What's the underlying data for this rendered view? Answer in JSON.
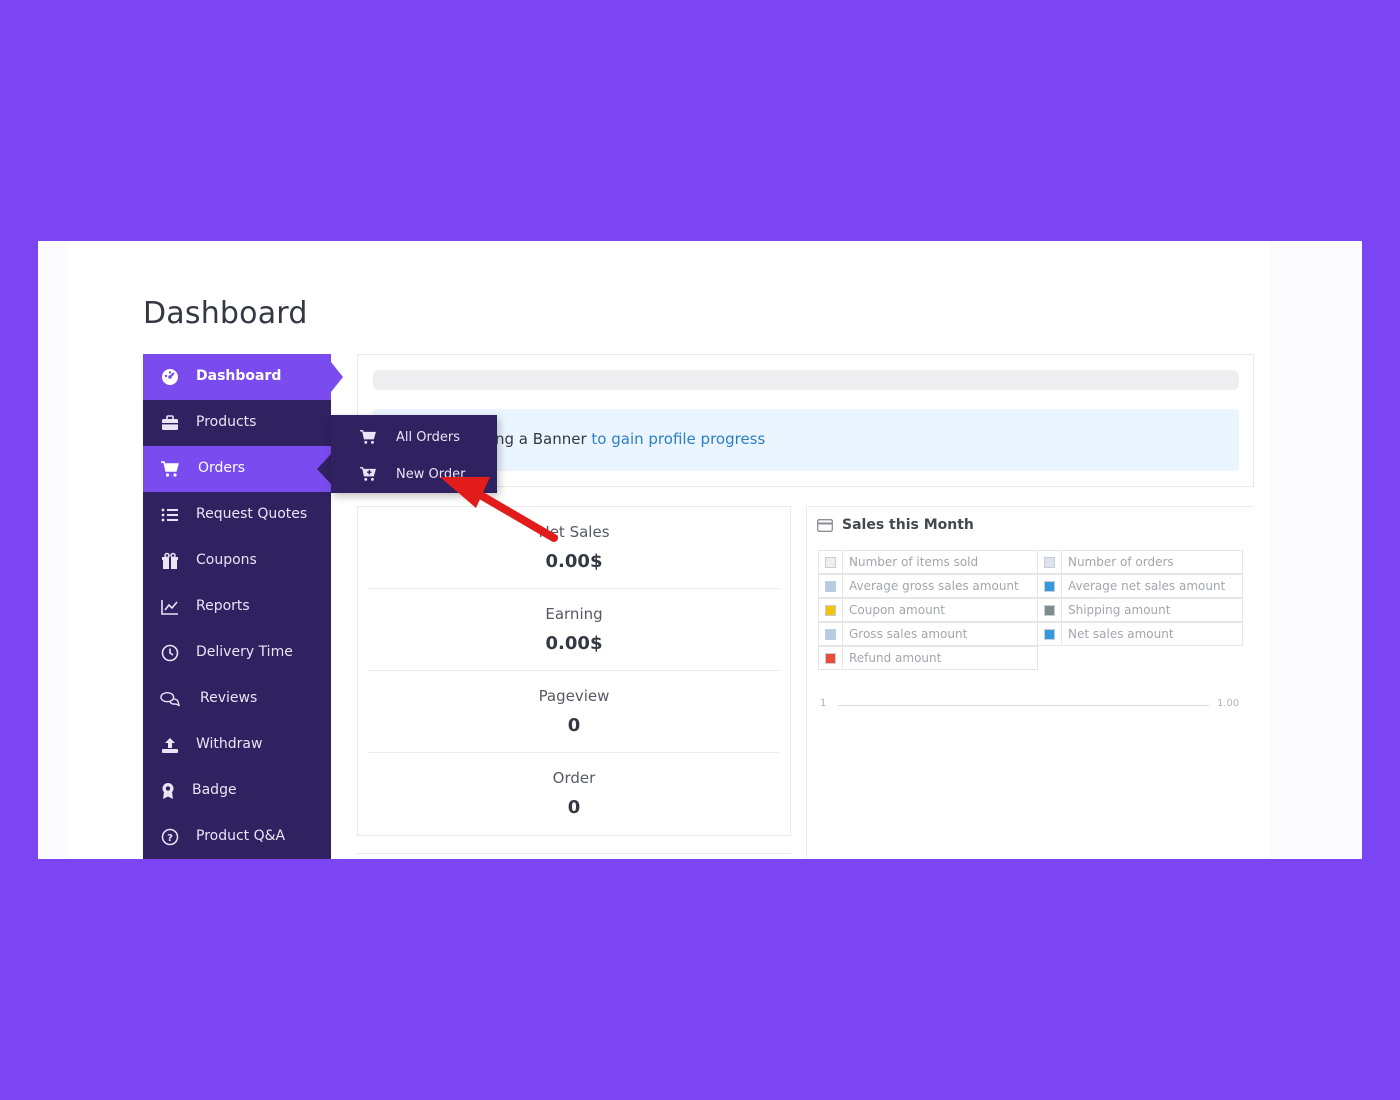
{
  "page": {
    "title": "Dashboard"
  },
  "sidebar": {
    "items": [
      {
        "label": "Dashboard",
        "icon": "dashboard-icon"
      },
      {
        "label": "Products",
        "icon": "briefcase-icon"
      },
      {
        "label": "Orders",
        "icon": "cart-icon"
      },
      {
        "label": "Request Quotes",
        "icon": "list-icon"
      },
      {
        "label": "Coupons",
        "icon": "gift-icon"
      },
      {
        "label": "Reports",
        "icon": "chart-line-icon"
      },
      {
        "label": "Delivery Time",
        "icon": "clock-icon"
      },
      {
        "label": "Reviews",
        "icon": "comments-icon"
      },
      {
        "label": "Withdraw",
        "icon": "upload-icon"
      },
      {
        "label": "Badge",
        "icon": "award-icon"
      },
      {
        "label": "Product Q&A",
        "icon": "question-icon"
      }
    ]
  },
  "orders_flyout": {
    "items": [
      {
        "label": "All Orders",
        "icon": "cart-icon"
      },
      {
        "label": "New Order",
        "icon": "cart-plus-icon"
      }
    ]
  },
  "banner": {
    "text": "ng a Banner ",
    "link_text": "to gain profile progress"
  },
  "stats": [
    {
      "label": "Net Sales",
      "value": "0.00$"
    },
    {
      "label": "Earning",
      "value": "0.00$"
    },
    {
      "label": "Pageview",
      "value": "0"
    },
    {
      "label": "Order",
      "value": "0"
    }
  ],
  "sales": {
    "title": "Sales this Month",
    "legend": [
      {
        "label": "Number of items sold",
        "color": "#eeeeee"
      },
      {
        "label": "Number of orders",
        "color": "#dbe4ee"
      },
      {
        "label": "Average gross sales amount",
        "color": "#b3cde6"
      },
      {
        "label": "Average net sales amount",
        "color": "#3498db"
      },
      {
        "label": "Coupon amount",
        "color": "#f1c40f"
      },
      {
        "label": "Shipping amount",
        "color": "#7f8c8d"
      },
      {
        "label": "Gross sales amount",
        "color": "#b3cde6"
      },
      {
        "label": "Net sales amount",
        "color": "#3498db"
      },
      {
        "label": "Refund amount",
        "color": "#e74c3c"
      }
    ],
    "axis_start": "1",
    "axis_end": "1.00"
  },
  "colors": {
    "background": "#7b45f3",
    "sidebar": "#302161",
    "accent": "#7a4cf0",
    "annotation_arrow": "#e21b1b"
  }
}
